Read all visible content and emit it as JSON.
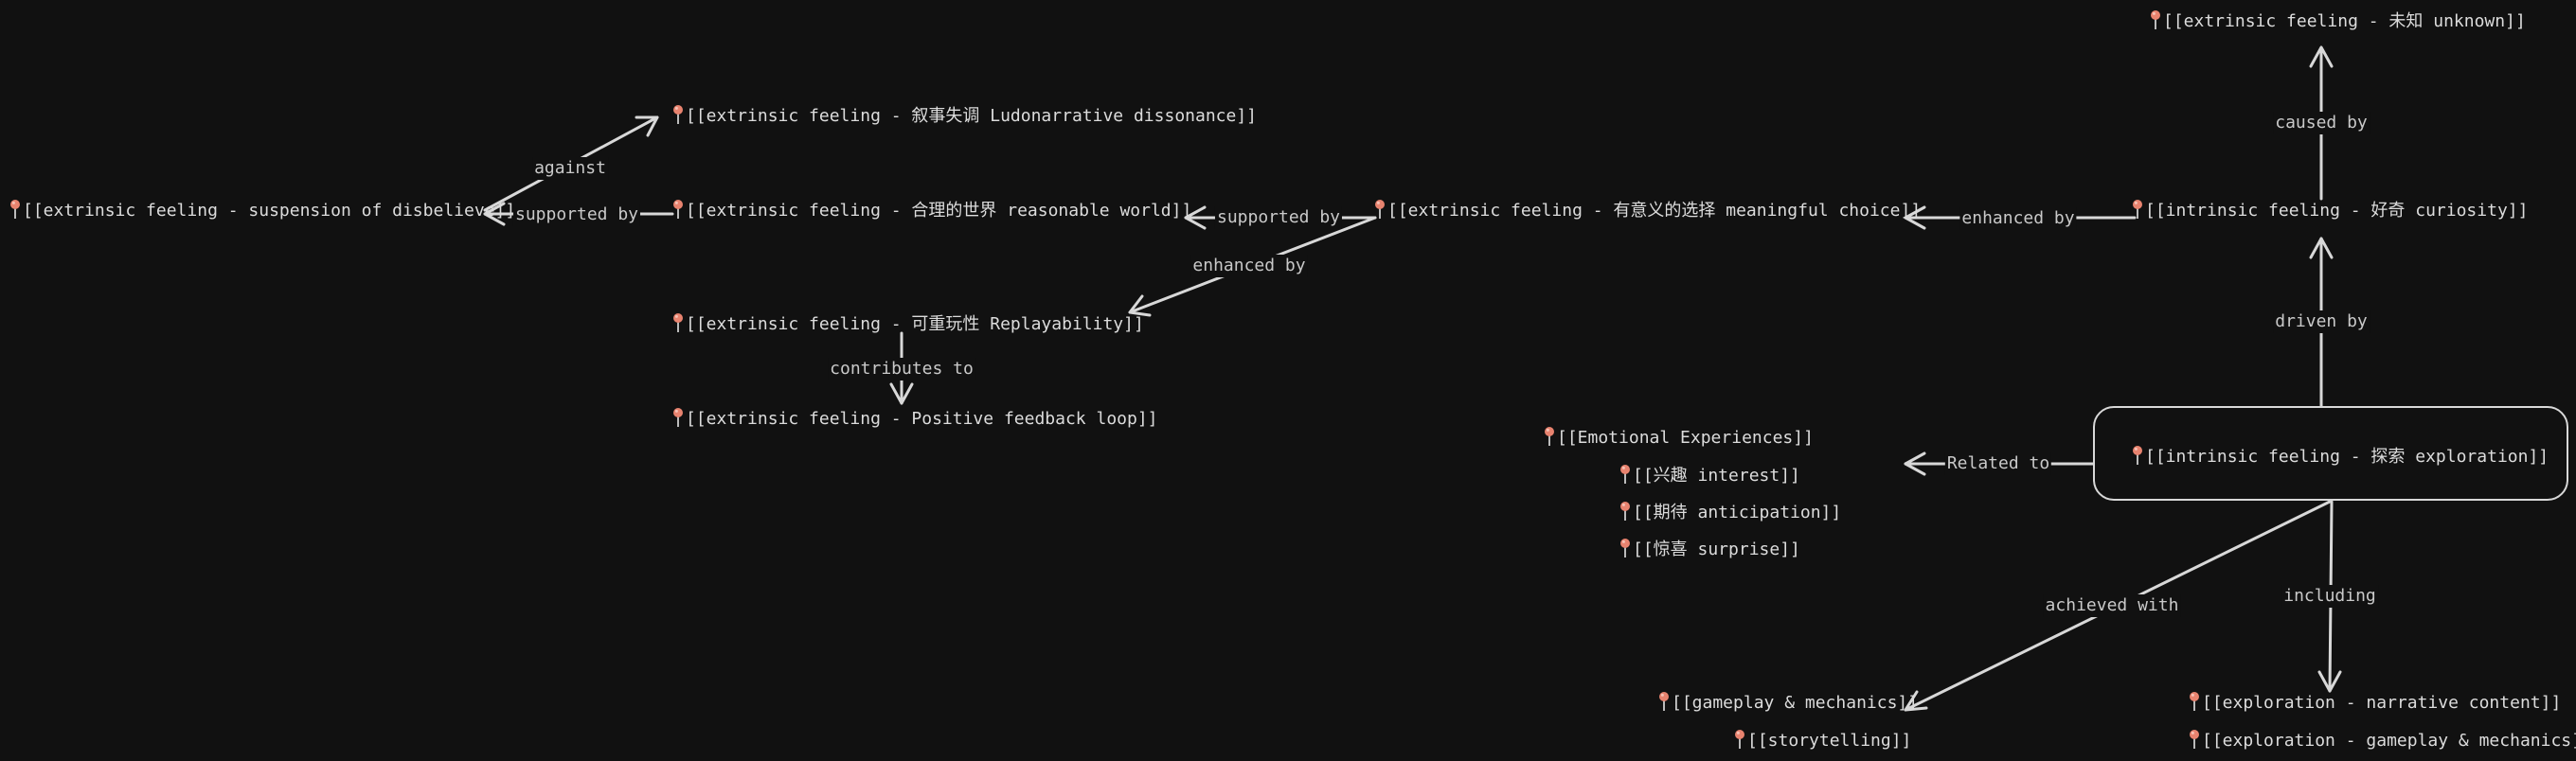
{
  "nodes": {
    "unknown": "[[extrinsic feeling - 未知 unknown]]",
    "ludonarrative": "[[extrinsic feeling - 叙事失调 Ludonarrative dissonance]]",
    "suspension": "[[extrinsic feeling - suspension of disbelieve]]",
    "reasonable_world": "[[extrinsic feeling - 合理的世界 reasonable world]]",
    "meaningful_choice": "[[extrinsic feeling - 有意义的选择 meaningful choice]]",
    "curiosity": "[[intrinsic feeling - 好奇 curiosity]]",
    "replayability": "[[extrinsic feeling - 可重玩性 Replayability]]",
    "feedback_loop": "[[extrinsic feeling - Positive feedback loop]]",
    "emotional": "[[Emotional Experiences]]",
    "interest": "[[兴趣 interest]]",
    "anticipation": "[[期待 anticipation]]",
    "surprise": "[[惊喜 surprise]]",
    "exploration": "[[intrinsic feeling - 探索 exploration]]",
    "gameplay_mechanics": "[[gameplay & mechanics]]",
    "storytelling": "[[storytelling]]",
    "exp_narrative": "[[exploration - narrative content]]",
    "exp_gameplay": "[[exploration - gameplay & mechanics]]"
  },
  "edges": {
    "caused_by": "caused by",
    "against": "against",
    "supported_by_1": "supported by",
    "supported_by_2": "supported by",
    "enhanced_by_1": "enhanced by",
    "enhanced_by_2": "enhanced by",
    "driven_by": "driven by",
    "contributes_to": "contributes to",
    "related_to": "Related to",
    "achieved_with": "achieved with",
    "including": "including"
  },
  "colors": {
    "background": "#111111",
    "text": "#dcdcdc",
    "edge": "#d8d8d8",
    "pin_head": "#e8836f",
    "pin_needle": "#e6e6e6"
  }
}
